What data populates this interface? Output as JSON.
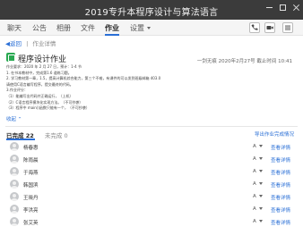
{
  "window": {
    "title": "2019专升本程序设计与算法语言"
  },
  "tabs": [
    {
      "label": "聊天"
    },
    {
      "label": "公告"
    },
    {
      "label": "相册"
    },
    {
      "label": "文件"
    },
    {
      "label": "作业"
    },
    {
      "label": "设置"
    }
  ],
  "active_tab": "作业",
  "breadcrumb": {
    "back": "返回",
    "separator": "|",
    "current": "作业详情"
  },
  "assignment": {
    "title": "程序设计作业",
    "meta": "一剑无痕 2020年2月27号 截止时间 10:41",
    "description": [
      "作业要求：2020 年 2 月 27 日，预计：1-4 节",
      "1. 在书本教材中，完成第1.6 道练习题。",
      "2. 学习教材第一章，1.5，提高计算机综合能力，第三个不难，有课件的可以发到班级邮箱 403.0",
      "请使用C语言编写程序，提交最终的代码。",
      "3.作业评分：",
      "（1）能编写出代码并正确运行，（上机）",
      "（2）C语言程序模块化实现方法。（不可抄袭）",
      "（3）程序中 main()函数只能有一个，（不可抄袭）"
    ],
    "collapse_label": "收起 ⌃"
  },
  "submissions": {
    "done_tab": "已完成 22",
    "pending_tab": "未完成 0",
    "export_label": "导出作业完成情况",
    "grade_label": "A",
    "view_label": "查看详情",
    "students": [
      {
        "name": "杨春惠"
      },
      {
        "name": "陈雨晨"
      },
      {
        "name": "于海燕"
      },
      {
        "name": "韩国滨"
      },
      {
        "name": "王晓丹"
      },
      {
        "name": "李洪亮"
      },
      {
        "name": "张艾英"
      }
    ]
  }
}
